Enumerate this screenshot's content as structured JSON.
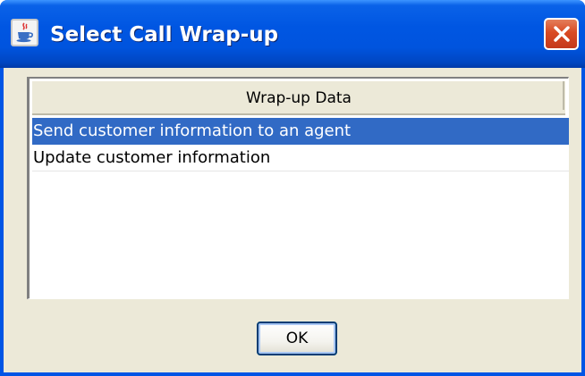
{
  "window": {
    "title": "Select Call Wrap-up",
    "icon": "java-cup-icon",
    "close_icon": "close-icon"
  },
  "table": {
    "columns": [
      "Wrap-up Data"
    ],
    "rows": [
      {
        "label": "Send customer information to an agent",
        "selected": true
      },
      {
        "label": "Update customer information",
        "selected": false
      }
    ]
  },
  "buttons": {
    "ok_label": "OK"
  },
  "colors": {
    "titlebar": "#0054de",
    "dialog_background": "#ece9d8",
    "selection": "#316ac5",
    "close_button": "#d94a23"
  }
}
